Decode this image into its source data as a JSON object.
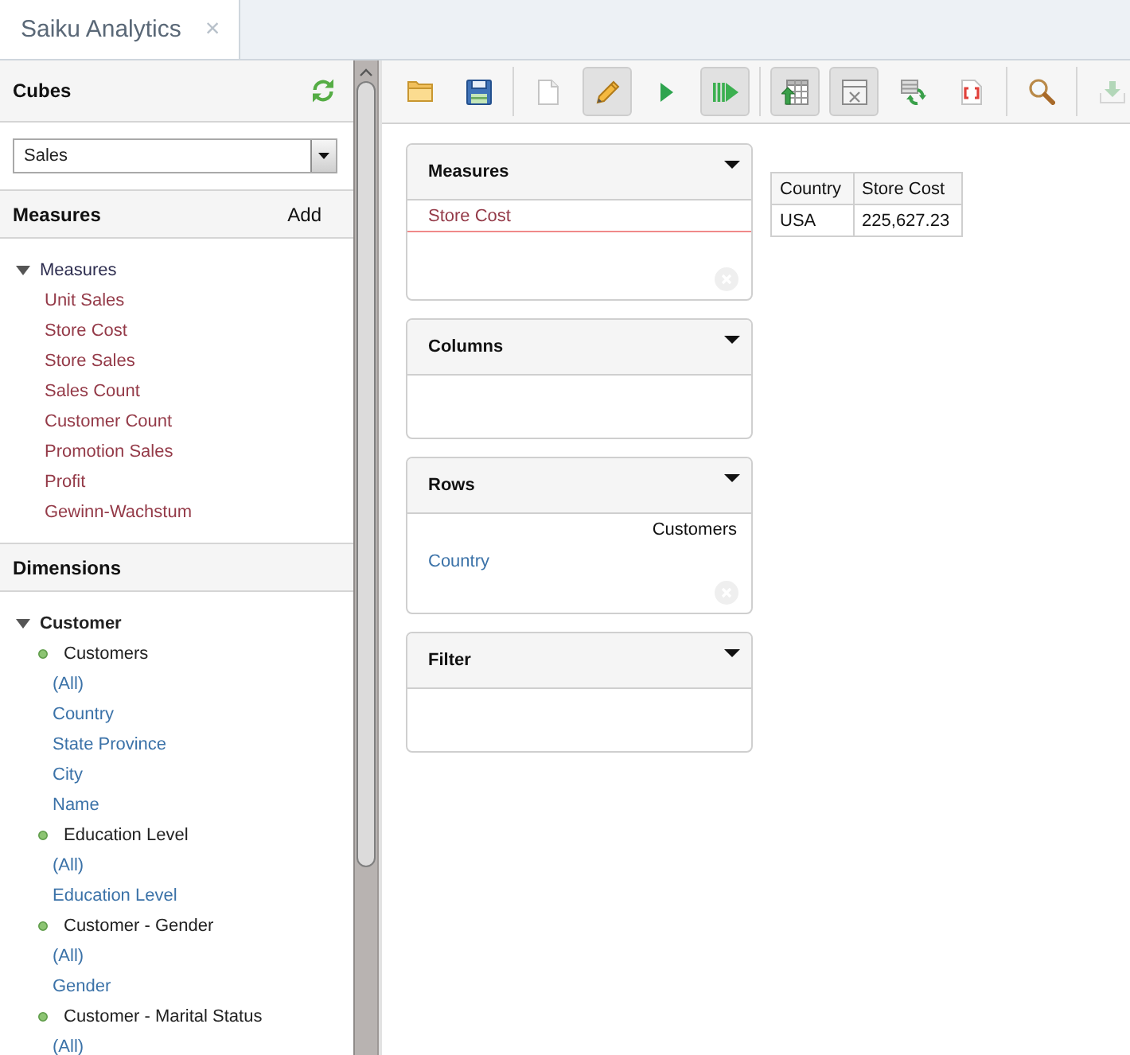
{
  "tabs": [
    {
      "label": "Saiku Analytics",
      "close": "×",
      "selected": true
    }
  ],
  "sidebar": {
    "cubes": {
      "title": "Cubes",
      "selected_cube": "Sales"
    },
    "measures": {
      "title": "Measures",
      "add": "Add",
      "tree": [
        {
          "label": "Measures",
          "expanded": true,
          "children": [
            {
              "label": "Unit Sales"
            },
            {
              "label": "Store Cost"
            },
            {
              "label": "Store Sales"
            },
            {
              "label": "Sales Count"
            },
            {
              "label": "Customer Count"
            },
            {
              "label": "Promotion Sales"
            },
            {
              "label": "Profit"
            },
            {
              "label": "Gewinn-Wachstum"
            }
          ]
        }
      ]
    },
    "dimensions": {
      "title": "Dimensions",
      "tree": [
        {
          "label": "Customer",
          "expanded": true,
          "children": [
            {
              "label": "Customers",
              "children": [
                {
                  "label": "(All)"
                },
                {
                  "label": "Country"
                },
                {
                  "label": "State Province"
                },
                {
                  "label": "City"
                },
                {
                  "label": "Name"
                }
              ]
            },
            {
              "label": "Education Level",
              "children": [
                {
                  "label": "(All)"
                },
                {
                  "label": "Education Level"
                }
              ]
            },
            {
              "label": "Customer - Gender",
              "children": [
                {
                  "label": "(All)"
                },
                {
                  "label": "Gender"
                }
              ]
            },
            {
              "label": "Customer - Marital Status",
              "children": [
                {
                  "label": "(All)"
                }
              ]
            }
          ]
        }
      ]
    }
  },
  "toolbar": {
    "groups": [
      [
        {
          "kind": "open",
          "on": false,
          "disabled": false
        },
        {
          "kind": "save",
          "on": false,
          "disabled": false
        }
      ],
      [
        {
          "kind": "new",
          "on": false,
          "disabled": false
        },
        {
          "kind": "edit",
          "on": true,
          "disabled": false
        },
        {
          "kind": "run",
          "on": false,
          "disabled": false
        },
        {
          "kind": "autorun",
          "on": true,
          "disabled": false
        }
      ],
      [
        {
          "kind": "nonempty",
          "on": true,
          "disabled": false
        },
        {
          "kind": "hide",
          "on": true,
          "disabled": false
        },
        {
          "kind": "swap",
          "on": false,
          "disabled": false
        },
        {
          "kind": "mdx",
          "on": false,
          "disabled": false
        }
      ],
      [
        {
          "kind": "zoom",
          "on": false,
          "disabled": false
        }
      ],
      [
        {
          "kind": "export",
          "on": false,
          "disabled": true
        }
      ]
    ]
  },
  "workspace": {
    "drop_zones": [
      {
        "title": "Measures",
        "items": [
          {
            "kind": "measure",
            "label": "Store Cost"
          }
        ]
      },
      {
        "title": "Columns"
      },
      {
        "title": "Rows",
        "items": [
          {
            "kind": "hierarchy",
            "label": "Customers",
            "levels": [
              "Country"
            ]
          }
        ]
      },
      {
        "title": "Filter"
      }
    ]
  },
  "table": {
    "columns": [
      "Country",
      "Store Cost"
    ],
    "rows": [
      [
        "USA",
        "225,627.23"
      ]
    ]
  }
}
